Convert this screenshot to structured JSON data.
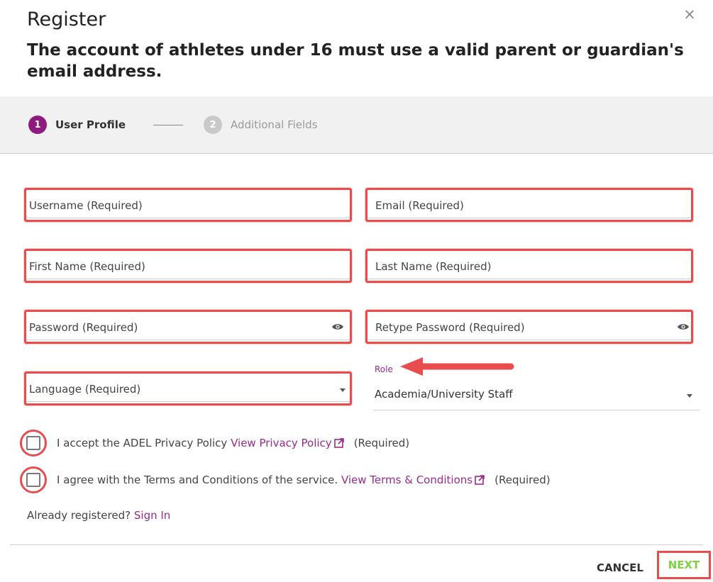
{
  "dialog": {
    "title": "Register",
    "close_glyph": "×",
    "subtitle": "The account of athletes under 16 must use a valid parent or guardian's email address."
  },
  "stepper": {
    "steps": [
      {
        "number": "1",
        "label": "User Profile",
        "state": "active"
      },
      {
        "number": "2",
        "label": "Additional Fields",
        "state": "inactive"
      }
    ]
  },
  "form": {
    "username": "Username (Required)",
    "email": "Email (Required)",
    "first_name": "First Name (Required)",
    "last_name": "Last Name (Required)",
    "password": "Password (Required)",
    "retype_password": "Retype Password (Required)",
    "language": "Language (Required)",
    "role_label": "Role",
    "role_value": "Academia/University Staff"
  },
  "consents": {
    "privacy_text": "I accept the ADEL Privacy Policy",
    "privacy_link": "View Privacy Policy",
    "privacy_required": "(Required)",
    "terms_text": "I agree with the Terms and Conditions of the service.",
    "terms_link": "View Terms & Conditions",
    "terms_required": "(Required)"
  },
  "signin": {
    "prompt": "Already registered?",
    "link": "Sign In"
  },
  "footer": {
    "cancel_label": "CANCEL",
    "next_label": "NEXT"
  },
  "colors": {
    "accent": "#9b2a8f",
    "step_active": "#8e1a7e",
    "highlight": "#e84c4c",
    "next": "#7fd142"
  },
  "icons": [
    "close-icon",
    "eye-icon",
    "chevron-down-icon",
    "external-link-icon",
    "arrow-icon"
  ]
}
